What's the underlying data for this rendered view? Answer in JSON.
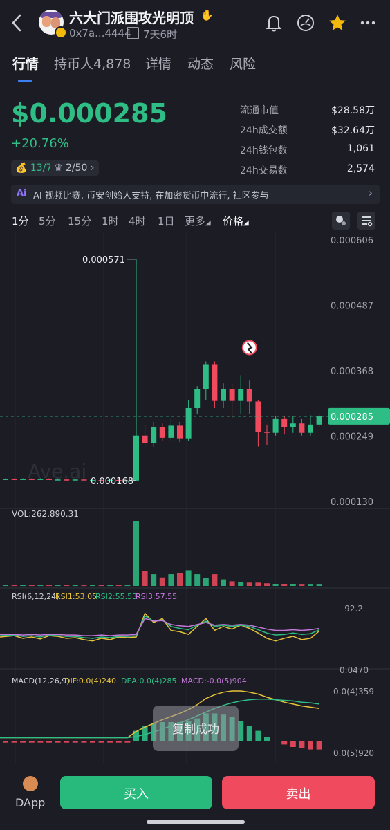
{
  "header": {
    "title": "六大门派围攻光明顶",
    "address": "0x7a...4444",
    "age": "7天6时",
    "icons": [
      "back-icon",
      "bell-icon",
      "gauge-icon",
      "star-icon",
      "more-icon"
    ],
    "star_color": "#f0b90b"
  },
  "tabs": [
    {
      "label": "行情",
      "active": true
    },
    {
      "label": "持币人4,878",
      "active": false
    },
    {
      "label": "详情",
      "active": false
    },
    {
      "label": "动态",
      "active": false
    },
    {
      "label": "风险",
      "active": false
    }
  ],
  "price": {
    "value": "$0.000285",
    "change": "+20.76%",
    "badge_holders": "13/7",
    "badge_rank": "2/50",
    "up_color": "#2ebd85",
    "down_color": "#ef4a5e"
  },
  "stats": [
    {
      "label": "流通市值",
      "value": "$28.58万"
    },
    {
      "label": "24h成交额",
      "value": "$32.64万"
    },
    {
      "label": "24h钱包数",
      "value": "1,061"
    },
    {
      "label": "24h交易数",
      "value": "2,574"
    }
  ],
  "ai_bar": {
    "tag": "Ai",
    "text": "AI 视频比赛, 币安创始人支持, 在加密货币中流行, 社区参与"
  },
  "timeframes": [
    {
      "label": "1分",
      "active": true
    },
    {
      "label": "5分",
      "active": false
    },
    {
      "label": "15分",
      "active": false
    },
    {
      "label": "1时",
      "active": false
    },
    {
      "label": "4时",
      "active": false
    },
    {
      "label": "1日",
      "active": false
    },
    {
      "label": "更多",
      "active": false
    },
    {
      "label": "价格",
      "active": true
    }
  ],
  "chart_data": [
    {
      "type": "candlestick",
      "price_axis": [
        "0.000606",
        "0.000487",
        "0.000368",
        "0.000249",
        "0.000130"
      ],
      "ylim": [
        0.00013,
        0.000606
      ],
      "current_price_label": "0.000285",
      "annotations": {
        "high": "0.000571",
        "low": "0.000168"
      },
      "watermark": "Ave.ai",
      "candles": [
        {
          "o": 0.00017,
          "c": 0.000171,
          "h": 0.000172,
          "l": 0.000169
        },
        {
          "o": 0.000171,
          "c": 0.00017,
          "h": 0.000172,
          "l": 0.000169
        },
        {
          "o": 0.00017,
          "c": 0.000171,
          "h": 0.000172,
          "l": 0.000169
        },
        {
          "o": 0.000171,
          "c": 0.00017,
          "h": 0.000172,
          "l": 0.000169
        },
        {
          "o": 0.00017,
          "c": 0.000171,
          "h": 0.000172,
          "l": 0.000169
        },
        {
          "o": 0.000171,
          "c": 0.00017,
          "h": 0.000172,
          "l": 0.000169
        },
        {
          "o": 0.00017,
          "c": 0.00017,
          "h": 0.000172,
          "l": 0.000169
        },
        {
          "o": 0.00017,
          "c": 0.000169,
          "h": 0.000171,
          "l": 0.000168
        },
        {
          "o": 0.000169,
          "c": 0.00017,
          "h": 0.000171,
          "l": 0.000168
        },
        {
          "o": 0.00017,
          "c": 0.000169,
          "h": 0.000171,
          "l": 0.000168
        },
        {
          "o": 0.000169,
          "c": 0.000169,
          "h": 0.00017,
          "l": 0.000168
        },
        {
          "o": 0.000169,
          "c": 0.000168,
          "h": 0.00017,
          "l": 0.000168
        },
        {
          "o": 0.000168,
          "c": 0.000169,
          "h": 0.00017,
          "l": 0.000168
        },
        {
          "o": 0.000169,
          "c": 0.000168,
          "h": 0.00017,
          "l": 0.000168
        },
        {
          "o": 0.000168,
          "c": 0.000168,
          "h": 0.000169,
          "l": 0.000168
        },
        {
          "o": 0.000168,
          "c": 0.00025,
          "h": 0.000571,
          "l": 0.000168
        },
        {
          "o": 0.00025,
          "c": 0.000236,
          "h": 0.00027,
          "l": 0.00023
        },
        {
          "o": 0.000236,
          "c": 0.000265,
          "h": 0.000275,
          "l": 0.00023
        },
        {
          "o": 0.000265,
          "c": 0.000246,
          "h": 0.000272,
          "l": 0.00024
        },
        {
          "o": 0.000246,
          "c": 0.000268,
          "h": 0.00028,
          "l": 0.00024
        },
        {
          "o": 0.000268,
          "c": 0.000245,
          "h": 0.000275,
          "l": 0.000238
        },
        {
          "o": 0.000245,
          "c": 0.0003,
          "h": 0.000315,
          "l": 0.00024
        },
        {
          "o": 0.0003,
          "c": 0.000335,
          "h": 0.00034,
          "l": 0.00029
        },
        {
          "o": 0.000335,
          "c": 0.00038,
          "h": 0.000385,
          "l": 0.000315
        },
        {
          "o": 0.00038,
          "c": 0.000313,
          "h": 0.000385,
          "l": 0.0003
        },
        {
          "o": 0.000313,
          "c": 0.000335,
          "h": 0.000345,
          "l": 0.0003
        },
        {
          "o": 0.000335,
          "c": 0.000313,
          "h": 0.000345,
          "l": 0.00028
        },
        {
          "o": 0.000313,
          "c": 0.000335,
          "h": 0.00036,
          "l": 0.00029
        },
        {
          "o": 0.000335,
          "c": 0.000312,
          "h": 0.00035,
          "l": 0.00029
        },
        {
          "o": 0.000312,
          "c": 0.000257,
          "h": 0.000315,
          "l": 0.00023
        },
        {
          "o": 0.000257,
          "c": 0.000255,
          "h": 0.00027,
          "l": 0.000232
        },
        {
          "o": 0.000255,
          "c": 0.00028,
          "h": 0.000286,
          "l": 0.00025
        },
        {
          "o": 0.00028,
          "c": 0.000265,
          "h": 0.000285,
          "l": 0.000252
        },
        {
          "o": 0.000265,
          "c": 0.000272,
          "h": 0.000285,
          "l": 0.000255
        },
        {
          "o": 0.000272,
          "c": 0.000255,
          "h": 0.00028,
          "l": 0.00025
        },
        {
          "o": 0.000255,
          "c": 0.00027,
          "h": 0.000287,
          "l": 0.00025
        },
        {
          "o": 0.00027,
          "c": 0.000285,
          "h": 0.00029,
          "l": 0.000265
        }
      ]
    },
    {
      "type": "bar",
      "label": "VOL:262,890.31",
      "values": [
        1,
        1,
        1,
        1,
        1,
        1,
        1,
        1,
        1,
        1,
        1,
        1,
        1,
        1,
        1,
        100,
        23,
        18,
        13,
        18,
        20,
        24,
        18,
        12,
        18,
        10,
        7,
        6,
        5,
        5,
        4,
        3,
        3,
        3,
        2,
        2,
        2
      ]
    },
    {
      "type": "line",
      "label": "RSI(6,12,24)",
      "ticks": [
        "92.2",
        "0.0470"
      ],
      "ylim": [
        0.047,
        92.2
      ],
      "series": [
        {
          "name": "RSI1:53.05",
          "color": "#e6c23a",
          "values": [
            44,
            46,
            42,
            44,
            41,
            46,
            45,
            42,
            43,
            40,
            38,
            42,
            40,
            44,
            43,
            44,
            80,
            66,
            72,
            54,
            52,
            48,
            60,
            72,
            54,
            60,
            56,
            62,
            57,
            50,
            42,
            38,
            42,
            45,
            40,
            42,
            53
          ]
        },
        {
          "name": "RSI2:55.53",
          "color": "#2ebd85",
          "values": [
            46,
            47,
            45,
            46,
            44,
            47,
            46,
            45,
            45,
            43,
            42,
            44,
            43,
            45,
            45,
            46,
            76,
            68,
            70,
            60,
            57,
            55,
            62,
            68,
            60,
            62,
            60,
            62,
            60,
            55,
            50,
            47,
            48,
            50,
            48,
            49,
            55
          ]
        },
        {
          "name": "RSI3:57.55",
          "color": "#c678dd",
          "values": [
            48,
            48,
            47,
            48,
            47,
            48,
            48,
            47,
            47,
            46,
            46,
            47,
            46,
            47,
            47,
            48,
            72,
            68,
            69,
            63,
            61,
            60,
            63,
            66,
            62,
            63,
            62,
            63,
            62,
            59,
            56,
            54,
            54,
            55,
            54,
            55,
            57
          ]
        }
      ]
    },
    {
      "type": "line",
      "label": "MACD(12,26,9)",
      "ticks": [
        "0.0(4)359",
        "0.0(5)920"
      ],
      "series": [
        {
          "name": "DIF:0.0(4)240",
          "color": "#e6c23a",
          "values": [
            0.5,
            0.5,
            0.5,
            0.5,
            0.5,
            0.5,
            0.5,
            0.5,
            0.5,
            0.5,
            0.5,
            0.5,
            0.5,
            0.5,
            0.5,
            1.5,
            2.2,
            2.8,
            3.4,
            3.9,
            4.4,
            5.0,
            5.8,
            6.8,
            7.4,
            7.8,
            8.0,
            8.0,
            7.8,
            7.5,
            7.0,
            6.6,
            6.2,
            5.9,
            5.6,
            5.4,
            5.2
          ]
        },
        {
          "name": "DEA:0.0(4)285",
          "color": "#2ebd85",
          "values": [
            0.5,
            0.5,
            0.5,
            0.5,
            0.5,
            0.5,
            0.5,
            0.5,
            0.5,
            0.5,
            0.5,
            0.5,
            0.5,
            0.5,
            0.5,
            0.7,
            1.0,
            1.4,
            1.9,
            2.4,
            2.9,
            3.4,
            4.0,
            4.6,
            5.2,
            5.7,
            6.1,
            6.4,
            6.6,
            6.7,
            6.7,
            6.6,
            6.5,
            6.4,
            6.2,
            6.1,
            5.9
          ]
        },
        {
          "name": "MACD:-0.0(5)904",
          "color": "#c678dd",
          "values": [
            -0.3,
            -0.3,
            -0.3,
            -0.3,
            -0.3,
            -0.3,
            -0.3,
            -0.3,
            -0.3,
            -0.3,
            -0.3,
            -0.3,
            -0.3,
            -0.3,
            -0.3,
            1.6,
            2.4,
            2.8,
            3.0,
            3.0,
            3.0,
            3.2,
            3.6,
            4.4,
            4.4,
            4.2,
            3.8,
            3.2,
            2.4,
            1.6,
            0.6,
            0.0,
            -0.6,
            -1.0,
            -1.2,
            -1.4,
            -1.4
          ]
        }
      ]
    }
  ],
  "toast": "复制成功",
  "footer": {
    "dapp": "DApp",
    "buy": "买入",
    "sell": "卖出"
  }
}
